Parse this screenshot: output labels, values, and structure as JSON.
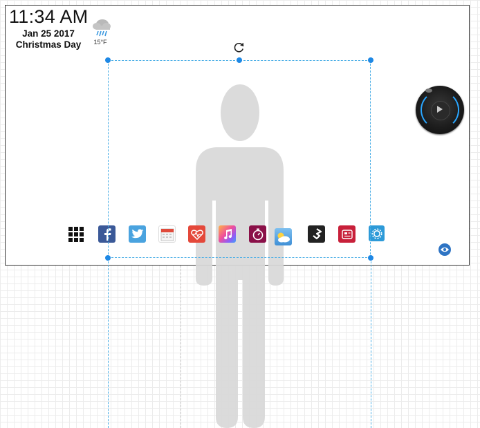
{
  "clock": {
    "time": "11:34 AM",
    "date": "Jan 25 2017",
    "holiday": "Christmas Day"
  },
  "weather": {
    "icon": "rain-cloud-icon",
    "temperature": "15°F"
  },
  "dock": {
    "apps": [
      {
        "name": "apps-grid",
        "icon": "grid-icon",
        "color": "#111111"
      },
      {
        "name": "facebook",
        "icon": "facebook-icon",
        "color": "#3b5998"
      },
      {
        "name": "twitter",
        "icon": "twitter-icon",
        "color": "#4aa3df"
      },
      {
        "name": "calendar",
        "icon": "calendar-icon",
        "color": "#e04b3c"
      },
      {
        "name": "health",
        "icon": "heart-pulse-icon",
        "color": "#e4483a"
      },
      {
        "name": "music",
        "icon": "music-note-icon",
        "color": "#f04e9b"
      },
      {
        "name": "timer",
        "icon": "stopwatch-icon",
        "color": "#8a1048"
      },
      {
        "name": "weather-app",
        "icon": "cloud-sun-icon",
        "color": "#4fa3e0"
      },
      {
        "name": "500px",
        "icon": "500px-icon",
        "color": "#222222"
      },
      {
        "name": "news",
        "icon": "news-icon",
        "color": "#c8203a"
      },
      {
        "name": "settings",
        "icon": "gear-icon",
        "color": "#2d9ad8"
      }
    ]
  },
  "controls": {
    "remote": "media-remote-icon",
    "eye": "eye-icon",
    "rotate": "rotate-icon"
  },
  "colors": {
    "selection": "#4aaee6",
    "handle": "#1e88e5",
    "silhouette": "#d9d9d9"
  }
}
